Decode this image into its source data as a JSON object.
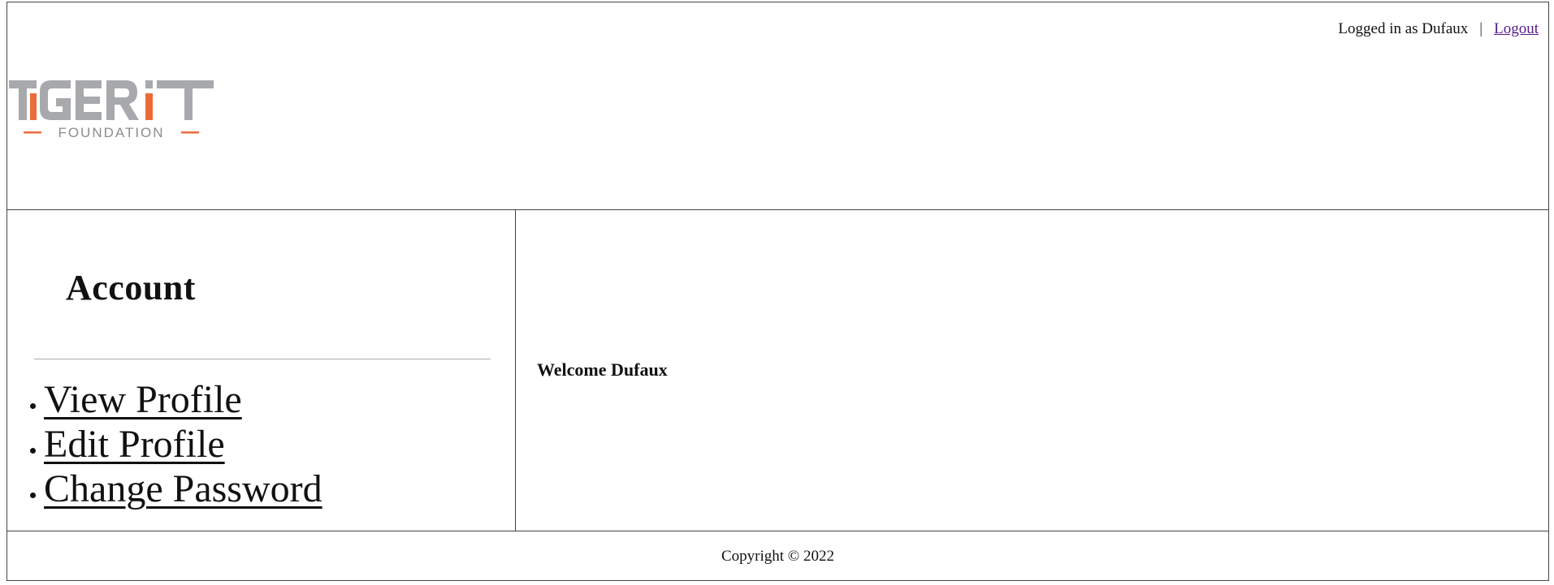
{
  "header": {
    "logged_in_text": "Logged in as Dufaux",
    "separator": "|",
    "logout_label": "Logout",
    "logo": {
      "name_left": "TIGER",
      "name_right": "IT",
      "tagline": "FOUNDATION",
      "gray_color": "#a7a9ac",
      "accent_color": "#ec6b3a"
    }
  },
  "sidebar": {
    "title": "Account",
    "items": [
      {
        "label": "View Profile"
      },
      {
        "label": "Edit Profile"
      },
      {
        "label": "Change Password"
      }
    ]
  },
  "content": {
    "welcome": "Welcome Dufaux"
  },
  "footer": {
    "copyright": "Copyright © 2022"
  }
}
